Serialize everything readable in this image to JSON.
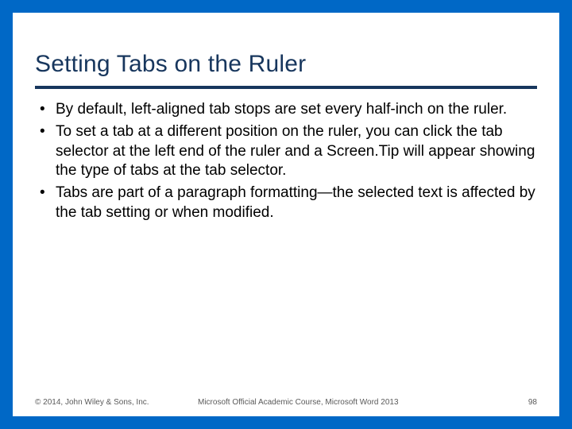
{
  "title": "Setting Tabs on the Ruler",
  "bullets": [
    "By default, left-aligned tab stops are set every half-inch on the ruler.",
    "To set a tab at a different position on the ruler, you can click the tab selector at the left end of the ruler and a Screen.Tip will appear showing the type of tabs at the tab selector.",
    "Tabs are part of a paragraph formatting—the selected text is affected by the tab setting or when modified."
  ],
  "footer": {
    "copyright": "© 2014, John Wiley & Sons, Inc.",
    "course": "Microsoft Official Academic Course, Microsoft Word 2013",
    "page": "98"
  }
}
